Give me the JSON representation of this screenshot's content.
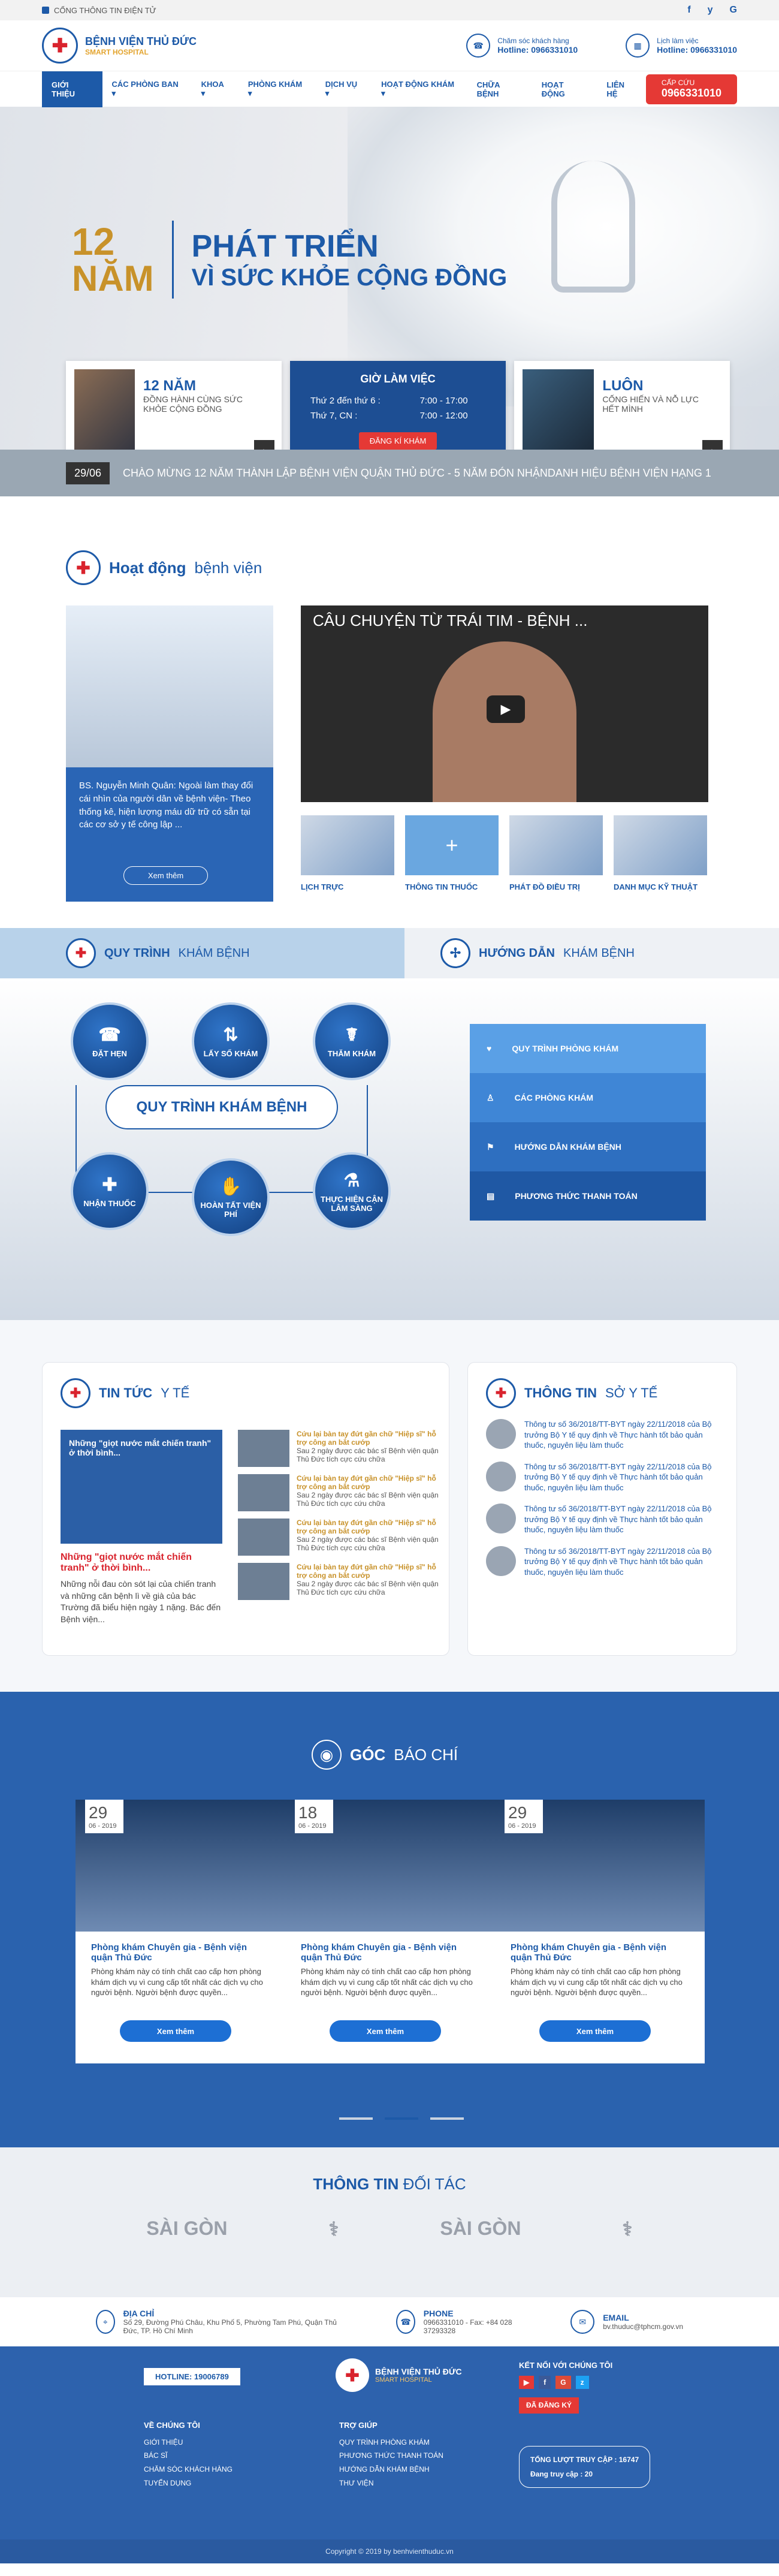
{
  "topstrip": {
    "link": "CỔNG THÔNG TIN ĐIỆN TỬ",
    "social": [
      "f",
      "y",
      "G"
    ]
  },
  "header": {
    "name": "BỆNH VIỆN THỦ ĐỨC",
    "sub": "SMART HOSPITAL",
    "contact1_label": "Chăm sóc khách hàng",
    "contact1_value": "Hotline: 0966331010",
    "contact2_label": "Lịch làm việc",
    "contact2_value": "Hotline: 0966331010"
  },
  "nav": {
    "items": [
      "GIỚI THIỆU",
      "CÁC PHÒNG BAN ▾",
      "KHOA ▾",
      "PHÒNG KHÁM ▾",
      "DỊCH VỤ ▾",
      "HOẠT ĐỘNG KHÁM ▾",
      "CHỮA BỆNH",
      "HOẠT ĐỘNG",
      "LIÊN HỆ"
    ],
    "emergency_label": "CẤP CỨU",
    "emergency_phone": "0966331010"
  },
  "hero": {
    "years_num": "12",
    "years_word": "NĂM",
    "line1": "PHÁT TRIỂN",
    "line2": "VÌ SỨC KHỎE CỘNG ĐỒNG",
    "card1_big": "12 NĂM",
    "card1_small": "ĐỒNG HÀNH CÙNG SỨC KHỎE CỘNG ĐỒNG",
    "hours_title": "GIỜ LÀM VIỆC",
    "hours": [
      {
        "day": "Thứ 2 đến thứ 6 :",
        "time": "7:00 - 17:00"
      },
      {
        "day": "Thứ 7, CN :",
        "time": "7:00 - 12:00"
      }
    ],
    "register_btn": "ĐĂNG KÍ KHÁM",
    "card3_big": "LUÔN",
    "card3_small": "CỐNG HIẾN VÀ NỖ LỰC HẾT MÌNH",
    "ticker_date": "29/06",
    "ticker_text": "CHÀO MỪNG 12 NĂM THÀNH LẬP BỆNH VIỆN QUẬN THỦ ĐỨC - 5 NĂM ĐÓN NHẬNDANH HIỆU BỆNH VIỆN HẠNG 1"
  },
  "activity": {
    "title_bold": "Hoạt động",
    "title_thin": "bệnh viện",
    "doctor_text": "BS. Nguyễn Minh Quân: Ngoài làm thay đổi cái nhìn của người dân về bệnh viện- Theo thống kê, hiện lượng máu dữ trữ có sẵn tại các cơ sở y tế công lập ...",
    "more_btn": "Xem thêm",
    "video_title": "CÂU CHUYỆN TỪ TRÁI TIM - BỆNH ...",
    "thumbs": [
      "LỊCH TRỰC",
      "THÔNG TIN THUỐC",
      "PHÁT ĐỒ ĐIỀU TRỊ",
      "DANH MỤC KỸ THUẬT"
    ]
  },
  "tabs": {
    "a_bold": "QUY TRÌNH",
    "a_thin": "KHÁM BỆNH",
    "b_bold": "HƯỚNG DẪN",
    "b_thin": "KHÁM BỆNH"
  },
  "process": {
    "center": "QUY TRÌNH KHÁM BỆNH",
    "nodes": [
      "ĐẶT HẸN",
      "LẤY SỐ KHÁM",
      "THĂM KHÁM",
      "NHẬN THUỐC",
      "HOÀN TẤT VIỆN PHÍ",
      "THỰC HIỆN CẬN LÂM SÀNG"
    ],
    "menu": [
      "QUY TRÌNH PHÒNG KHÁM",
      "CÁC PHÒNG KHÁM",
      "HƯỚNG DẪN KHÁM BỆNH",
      "PHƯƠNG THỨC THANH TOÁN"
    ],
    "menu_colors": [
      "#5aa0e6",
      "#3f86d6",
      "#2e6fc0",
      "#1f58a4"
    ]
  },
  "news": {
    "left_bold": "TIN TỨC",
    "left_thin": "Y TẾ",
    "main_img_text": "Những \"giọt nước mắt chiến tranh\" ở thời bình...",
    "main_title": "Những \"giọt nước mắt chiến tranh\" ở thời bình...",
    "main_desc": "Những nỗi đau còn sót lại của chiến tranh và những căn bệnh lì về già của bác Trường đã biểu hiện ngày 1 nặng. Bác đến Bệnh viện...",
    "items": [
      {
        "title": "Cứu lại bàn tay đứt gần chữ \"Hiệp sĩ\" hỗ trợ công an bắt cướp",
        "desc": "Sau 2 ngày được các bác sĩ Bệnh viện quận Thủ Đức tích cực cứu chữa"
      },
      {
        "title": "Cứu lại bàn tay đứt gần chữ \"Hiệp sĩ\" hỗ trợ công an bắt cướp",
        "desc": "Sau 2 ngày được các bác sĩ Bệnh viện quận Thủ Đức tích cực cứu chữa"
      },
      {
        "title": "Cứu lại bàn tay đứt gần chữ \"Hiệp sĩ\" hỗ trợ công an bắt cướp",
        "desc": "Sau 2 ngày được các bác sĩ Bệnh viện quận Thủ Đức tích cực cứu chữa"
      },
      {
        "title": "Cứu lại bàn tay đứt gần chữ \"Hiệp sĩ\" hỗ trợ công an bắt cướp",
        "desc": "Sau 2 ngày được các bác sĩ Bệnh viện quận Thủ Đức tích cực cứu chữa"
      }
    ],
    "right_bold": "THÔNG TIN",
    "right_thin": "SỞ Y TẾ",
    "right_items": [
      "Thông tư số 36/2018/TT-BYT ngày 22/11/2018 của Bộ trưởng Bộ Y tế quy định về Thực hành tốt bảo quản thuốc, nguyên liệu làm thuốc",
      "Thông tư số 36/2018/TT-BYT ngày 22/11/2018 của Bộ trưởng Bộ Y tế quy định về Thực hành tốt bảo quản thuốc, nguyên liệu làm thuốc",
      "Thông tư số 36/2018/TT-BYT ngày 22/11/2018 của Bộ trưởng Bộ Y tế quy định về Thực hành tốt bảo quản thuốc, nguyên liệu làm thuốc",
      "Thông tư số 36/2018/TT-BYT ngày 22/11/2018 của Bộ trưởng Bộ Y tế quy định về Thực hành tốt bảo quản thuốc, nguyên liệu làm thuốc"
    ]
  },
  "press": {
    "bold": "GÓC",
    "thin": "BÁO CHÍ",
    "cards": [
      {
        "day": "29",
        "month": "06 - 2019",
        "title": "Phòng khám Chuyên gia - Bệnh viện quận Thủ Đức",
        "desc": "Phòng khám này có tính chất cao cấp hơn phòng khám dịch vụ vì cung cấp tốt nhất các dịch vụ cho người bệnh. Người bệnh được quyền...",
        "btn": "Xem thêm"
      },
      {
        "day": "18",
        "month": "06 - 2019",
        "title": "Phòng khám Chuyên gia - Bệnh viện quận Thủ Đức",
        "desc": "Phòng khám này có tính chất cao cấp hơn phòng khám dịch vụ vì cung cấp tốt nhất các dịch vụ cho người bệnh. Người bệnh được quyền...",
        "btn": "Xem thêm"
      },
      {
        "day": "29",
        "month": "06 - 2019",
        "title": "Phòng khám Chuyên gia - Bệnh viện quận Thủ Đức",
        "desc": "Phòng khám này có tính chất cao cấp hơn phòng khám dịch vụ vì cung cấp tốt nhất các dịch vụ cho người bệnh. Người bệnh được quyền...",
        "btn": "Xem thêm"
      }
    ]
  },
  "partners": {
    "bold": "THÔNG TIN",
    "thin": "ĐỐI TÁC",
    "logos": [
      "SÀI GÒN",
      "⚕",
      "SÀI GÒN",
      "⚕"
    ]
  },
  "contactbar": {
    "addr_h": "ĐỊA CHỈ",
    "addr_v": "Số 29, Đường Phú Châu, Khu Phố 5, Phường Tam Phú, Quận Thủ Đức, TP. Hồ Chí Minh",
    "phone_h": "PHONE",
    "phone_v": "0966331010 - Fax: +84 028 37293328",
    "email_h": "EMAIL",
    "email_v": "bv.thuduc@tphcm.gov.vn"
  },
  "footer": {
    "hotline": "HOTLINE: 19006789",
    "name": "BỆNH VIỆN THỦ ĐỨC",
    "sub": "SMART HOSPITAL",
    "connect": "KẾT NỐI VỚI CHÚNG TÔI",
    "about_h": "VỀ CHÚNG TÔI",
    "about": [
      "GIỚI THIỆU",
      "BÁC SĨ",
      "CHĂM SÓC KHÁCH HÀNG",
      "TUYỂN DỤNG"
    ],
    "help_h": "TRỢ GIÚP",
    "help": [
      "QUY TRÌNH PHÒNG KHÁM",
      "PHƯƠNG THỨC THANH TOÁN",
      "HƯỚNG DẪN KHÁM BỆNH",
      "THƯ VIỆN"
    ],
    "registered": "ĐÃ ĐĂNG KÝ",
    "visits": "TỔNG LƯỢT TRUY CẬP : 16747",
    "today": "Đang truy cập : 20",
    "copyright": "Copyright © 2019 by benhvienthuduc.vn"
  }
}
